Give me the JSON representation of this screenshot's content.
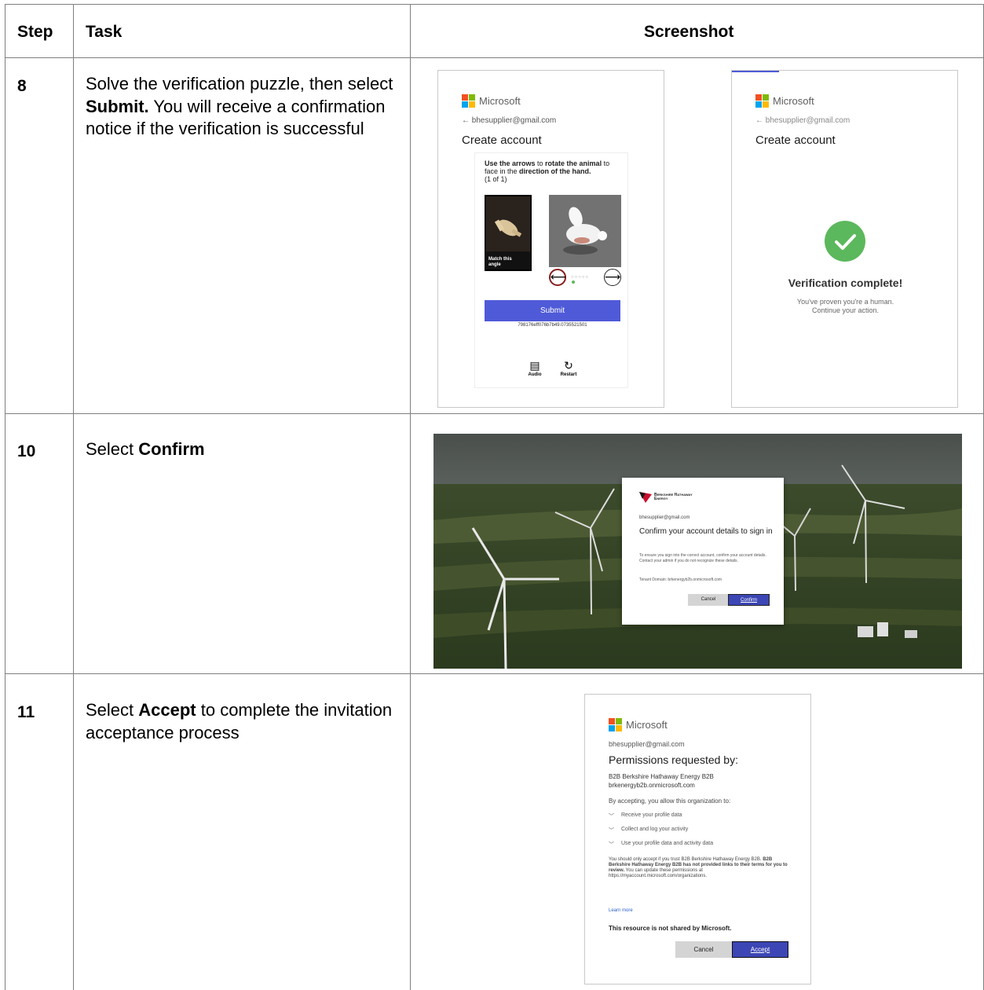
{
  "table": {
    "headers": {
      "step": "Step",
      "task": "Task",
      "screenshot": "Screenshot"
    }
  },
  "rows": [
    {
      "step": "8",
      "task_parts": [
        "Solve the verification puzzle, then select ",
        "Submit.",
        " You will receive a confirmation notice if the verification is successful"
      ]
    },
    {
      "step": "10",
      "task_parts": [
        "Select ",
        "Confirm"
      ]
    },
    {
      "step": "11",
      "task_parts": [
        "Select ",
        "Accept",
        " to complete the invitation acceptance process"
      ]
    }
  ],
  "shot8a": {
    "brand": "Microsoft",
    "back_email": "← bhesupplier@gmail.com",
    "title": "Create account",
    "instr_bold_1": "Use the arrows",
    "instr_2": " to ",
    "instr_bold_3": "rotate the animal",
    "instr_4": " to face in the ",
    "instr_bold_5": "direction of the hand.",
    "instr_count": "(1 of 1)",
    "match_label": "Match this angle",
    "submit": "Submit",
    "code": "798176eff076b7b49.0735521501",
    "audio": "Audio",
    "restart": "Restart"
  },
  "shot8b": {
    "brand": "Microsoft",
    "back_email": "← bhesupplier@gmail.com",
    "title": "Create account",
    "complete": "Verification complete!",
    "msg1": "You've proven you're a human.",
    "msg2": "Continue your action."
  },
  "shot10": {
    "brand_line1": "Berkshire Hathaway",
    "brand_line2": "Energy",
    "email": "bhesupplier@gmail.com",
    "title": "Confirm your account details to sign in",
    "body": "To ensure you sign into the correct account, confirm your account details. Contact your admin if you do not recognize these details.",
    "tenant": "Tenant Domain: brkenergyb2b.onmicrosoft.com",
    "cancel": "Cancel",
    "confirm": "Confirm"
  },
  "shot11": {
    "brand": "Microsoft",
    "email": "bhesupplier@gmail.com",
    "title": "Permissions requested by:",
    "org_name": "B2B Berkshire Hathaway Energy B2B",
    "org_domain": "brkenergyb2b.onmicrosoft.com",
    "intro": "By accepting, you allow this organization to:",
    "perms": [
      "Receive your profile data",
      "Collect and log your activity",
      "Use your profile data and activity data"
    ],
    "notice_1": "You should only accept if you trust B2B Berkshire Hathaway Energy B2B. ",
    "notice_bold": "B2B Berkshire Hathaway Energy B2B has not provided links to their terms for you to review.",
    "notice_2": " You can update these permissions at https://myaccount.microsoft.com/organizations.",
    "learn_more": "Learn more",
    "not_shared": "This resource is not shared by Microsoft.",
    "cancel": "Cancel",
    "accept": "Accept"
  },
  "colors": {
    "ms_red": "#f25022",
    "ms_green": "#7fba00",
    "ms_blue": "#00a4ef",
    "ms_yellow": "#ffb900",
    "submit_blue": "#4f5ad8",
    "accept_blue": "#3c46b4",
    "check_green": "#5cb85c",
    "bhe_red": "#c8102e"
  }
}
